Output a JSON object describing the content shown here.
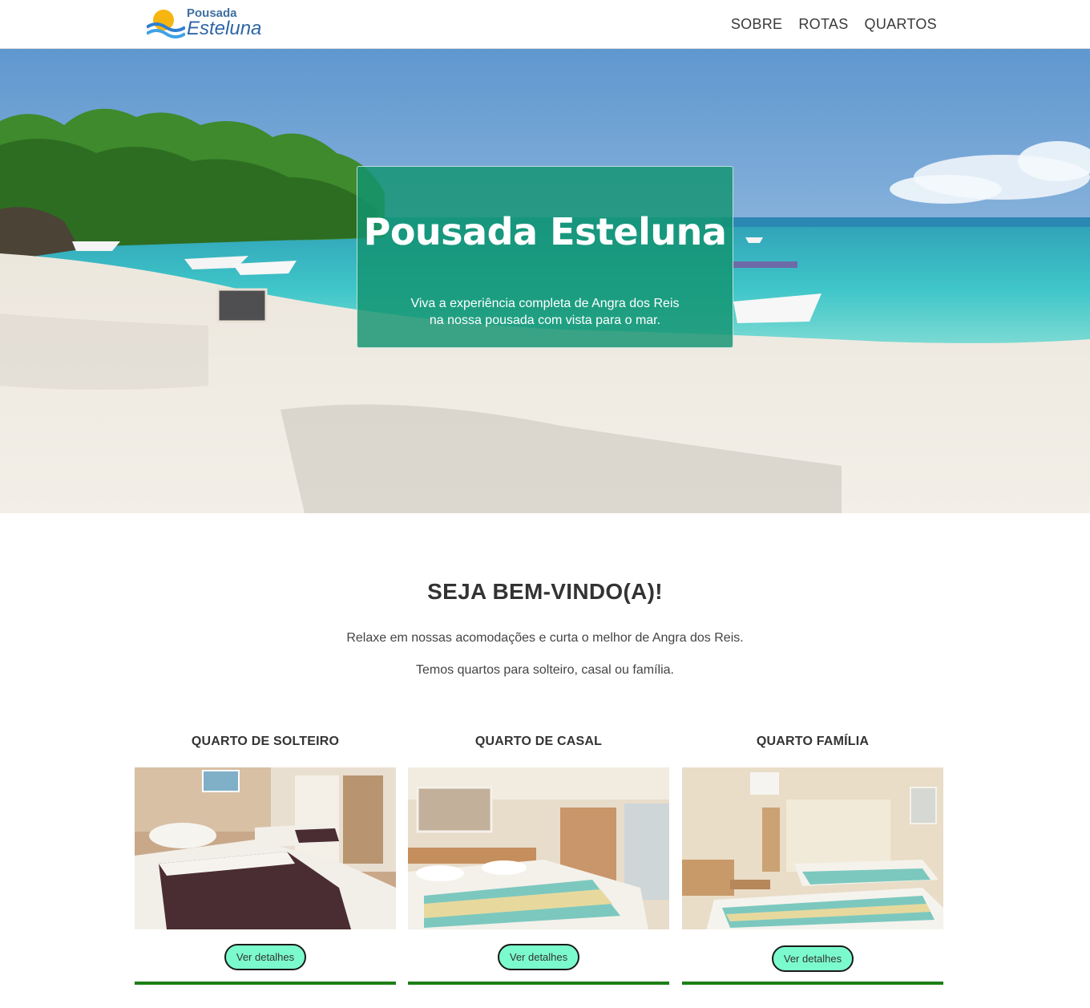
{
  "brand": {
    "top": "Pousada",
    "main": "Esteluna",
    "sun_color": "#f6b60f",
    "wave_color": "#2e7fd1"
  },
  "nav": {
    "items": [
      {
        "label": "SOBRE"
      },
      {
        "label": "ROTAS"
      },
      {
        "label": "QUARTOS"
      }
    ]
  },
  "hero": {
    "title": "Pousada Esteluna",
    "subtitle_line1": "Viva a experiência completa de Angra dos Reis",
    "subtitle_line2": "na nossa pousada com vista para o mar.",
    "card_color": "#129470"
  },
  "welcome": {
    "title": "SEJA BEM-VINDO(A)!",
    "p1": "Relaxe em nossas acomodações e curta o melhor de Angra dos Reis.",
    "p2": "Temos quartos para solteiro, casal ou família."
  },
  "rooms": [
    {
      "title": "QUARTO DE SOLTEIRO",
      "button": "Ver detalhes"
    },
    {
      "title": "QUARTO DE CASAL",
      "button": "Ver detalhes"
    },
    {
      "title": "QUARTO FAMÍLIA",
      "button": "Ver detalhes"
    }
  ],
  "accent": {
    "button_bg": "#7bfbcd",
    "underline": "#1d7f16"
  }
}
